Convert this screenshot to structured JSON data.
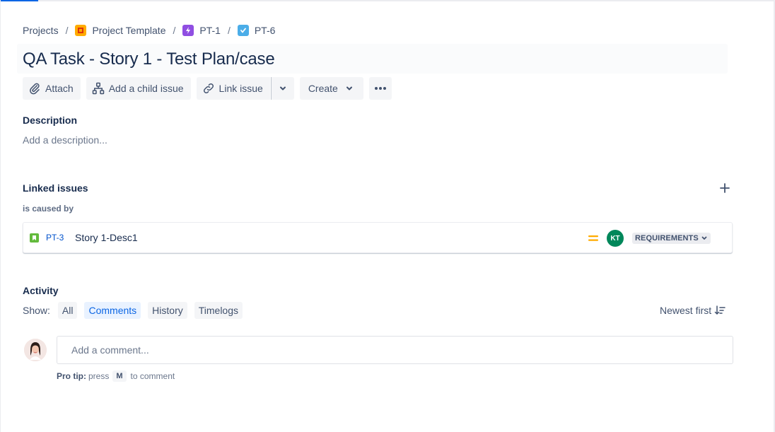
{
  "breadcrumb": {
    "projects": "Projects",
    "sep": "/",
    "project": "Project Template",
    "epic": "PT-1",
    "issue": "PT-6"
  },
  "issue": {
    "title": "QA Task - Story 1 - Test Plan/case"
  },
  "toolbar": {
    "attach": "Attach",
    "add_child": "Add a child issue",
    "link_issue": "Link issue",
    "create": "Create"
  },
  "description": {
    "label": "Description",
    "placeholder": "Add a description..."
  },
  "linked_issues": {
    "label": "Linked issues",
    "relation": "is caused by",
    "items": [
      {
        "key": "PT-3",
        "summary": "Story 1-Desc1",
        "assignee_initials": "KT",
        "status": "REQUIREMENTS"
      }
    ]
  },
  "activity": {
    "label": "Activity",
    "show_label": "Show:",
    "filters": [
      "All",
      "Comments",
      "History",
      "Timelogs"
    ],
    "active_filter": "Comments",
    "sort": "Newest first"
  },
  "comment": {
    "placeholder": "Add a comment...",
    "protip_label": "Pro tip:",
    "protip_press": "press",
    "protip_key": "M",
    "protip_suffix": "to comment"
  },
  "colors": {
    "accent": "#0c66e4",
    "status_bg": "#ebecf0",
    "avatar_green": "#00875a",
    "priority_medium": "#ffab00"
  },
  "icons": [
    "paperclip-icon",
    "hierarchy-icon",
    "link-icon",
    "chevron-down-icon",
    "more-icon",
    "plus-icon",
    "story-icon",
    "priority-medium-icon",
    "sort-icon"
  ]
}
